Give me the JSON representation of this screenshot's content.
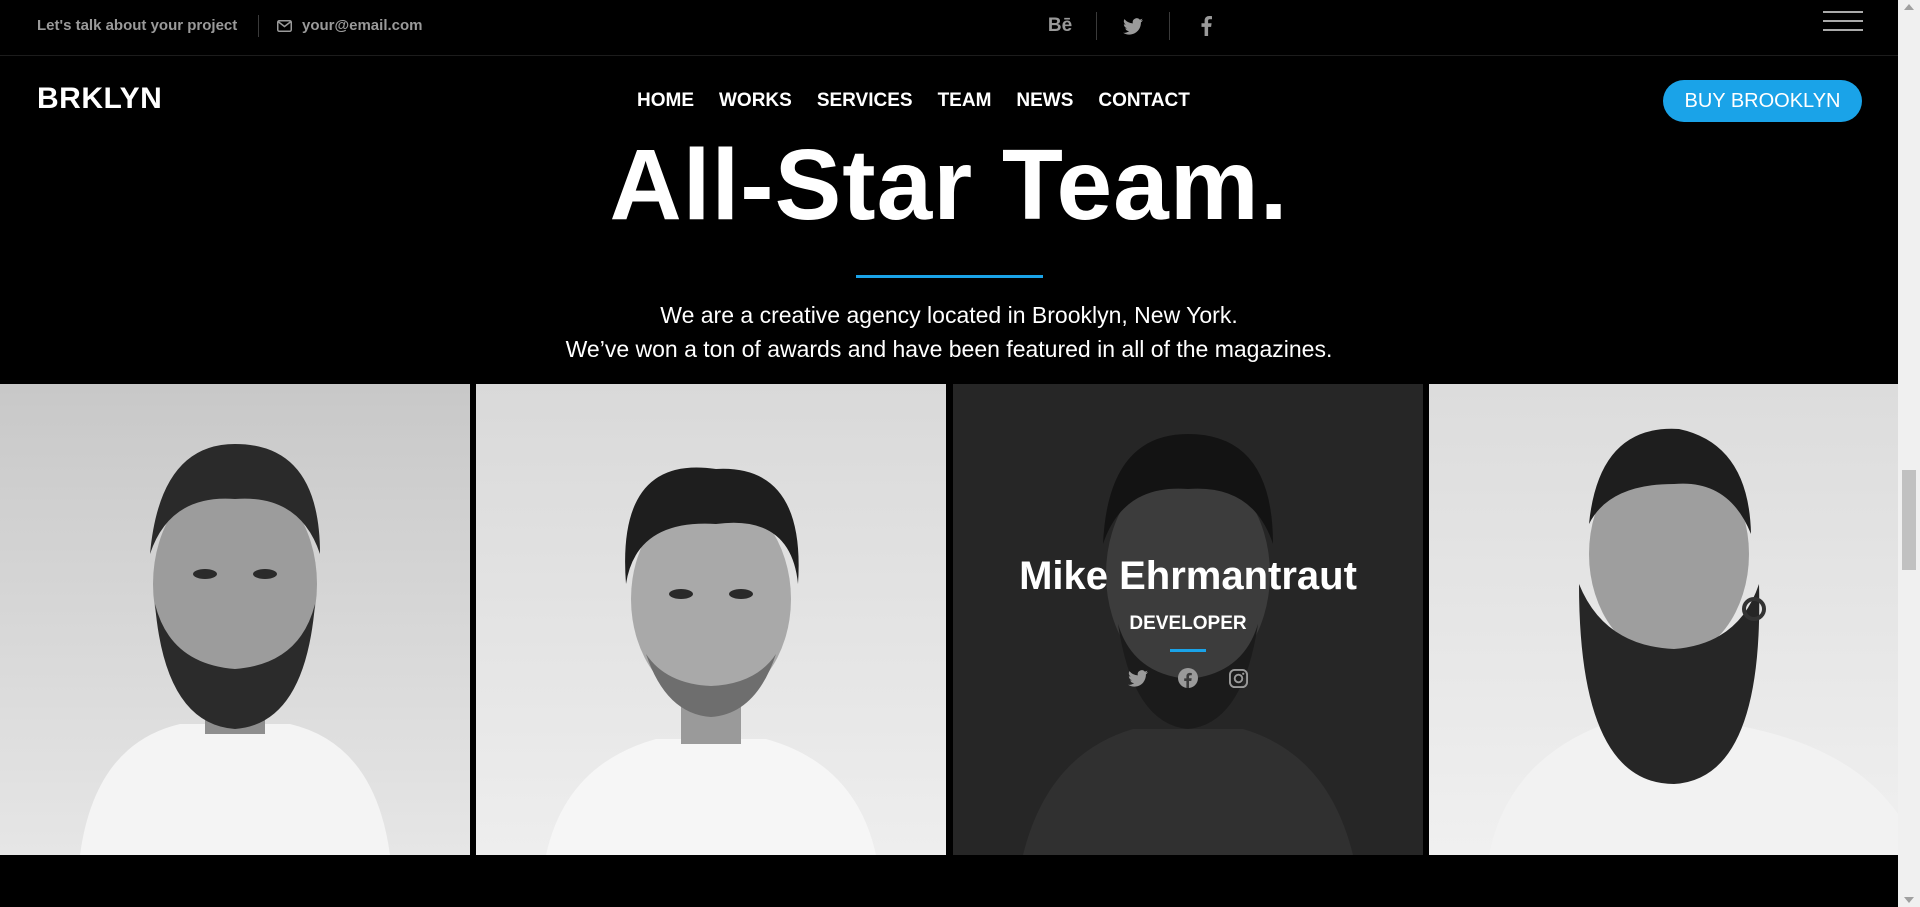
{
  "topbar": {
    "tagline": "Let's talk about your project",
    "email": "your@email.com",
    "social": [
      "behance-icon",
      "twitter-icon",
      "facebook-icon"
    ],
    "behance_label": "Bē"
  },
  "nav": {
    "logo": "BRKLYN",
    "items": [
      "HOME",
      "WORKS",
      "SERVICES",
      "TEAM",
      "NEWS",
      "CONTACT"
    ],
    "cta": "BUY BROOKLYN"
  },
  "hero": {
    "title": "All-Star Team.",
    "line1": "We are a creative agency located in Brooklyn, New York.",
    "line2": "We’ve won a ton of awards and have been featured in all of the magazines."
  },
  "team": {
    "highlight": {
      "name": "Mike Ehrmantraut",
      "role": "DEVELOPER",
      "social": [
        "twitter-icon",
        "facebook-icon",
        "instagram-icon"
      ]
    }
  },
  "colors": {
    "accent": "#1aa3e8",
    "background": "#000000",
    "muted_text": "#9a9a9a"
  }
}
